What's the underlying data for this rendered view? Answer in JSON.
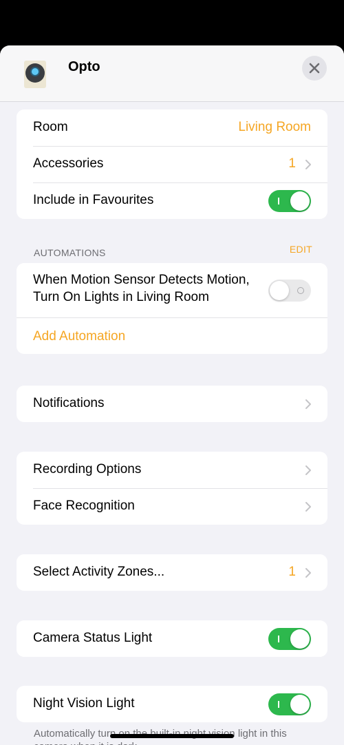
{
  "header": {
    "title": "Opto",
    "icon": "camera-icon",
    "close_icon": "close-icon"
  },
  "general": {
    "room_label": "Room",
    "room_value": "Living Room",
    "accessories_label": "Accessories",
    "accessories_value": "1",
    "favourites_label": "Include in Favourites",
    "favourites_on": true
  },
  "automations": {
    "section_title": "AUTOMATIONS",
    "edit_label": "EDIT",
    "item_text": "When Motion Sensor Detects Motion, Turn On Lights in Living Room",
    "item_enabled": false,
    "add_label": "Add Automation"
  },
  "notifications": {
    "label": "Notifications"
  },
  "recording": {
    "recording_options_label": "Recording Options",
    "face_recognition_label": "Face Recognition"
  },
  "activity_zones": {
    "label": "Select Activity Zones...",
    "value": "1"
  },
  "status_light": {
    "label": "Camera Status Light",
    "on": true
  },
  "night_vision": {
    "label": "Night Vision Light",
    "on": true,
    "footnote": "Automatically turn on the built-in night vision light in this camera when it is dark."
  },
  "colors": {
    "accent": "#f5a623",
    "toggle_on": "#2db84d",
    "background": "#f2f2f7"
  }
}
